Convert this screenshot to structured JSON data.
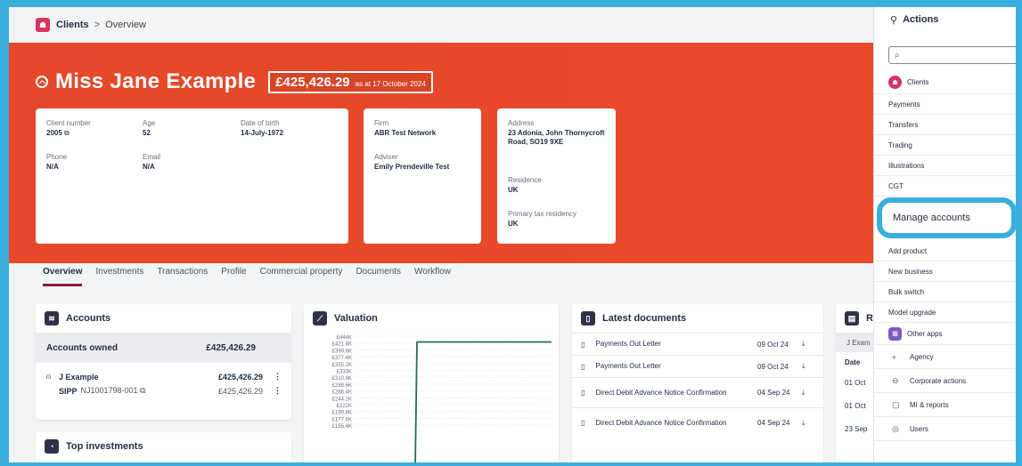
{
  "breadcrumb": {
    "root": "Clients",
    "sep": ">",
    "current": "Overview"
  },
  "client": {
    "name": "Miss Jane Example",
    "total": "£425,426.29",
    "as_at": "as at 17 October 2024",
    "labels": {
      "client_number": "Client number",
      "age": "Age",
      "dob": "Date of birth",
      "phone": "Phone",
      "email": "Email",
      "firm": "Firm",
      "adviser": "Adviser",
      "address": "Address",
      "residence": "Residence",
      "tax_residency": "Primary tax residency"
    },
    "client_number": "2005",
    "age": "52",
    "dob": "14-July-1972",
    "phone": "N/A",
    "email": "N/A",
    "firm": "ABR Test Network",
    "adviser": "Emily Prendeville Test",
    "address": "23 Adonia, John Thornycroft Road, SO19 9XE",
    "residence": "UK",
    "tax_residency": "UK"
  },
  "tabs": [
    "Overview",
    "Investments",
    "Transactions",
    "Profile",
    "Commercial property",
    "Documents",
    "Workflow"
  ],
  "accounts": {
    "title": "Accounts",
    "owned_label": "Accounts owned",
    "owned_total": "£425,426.29",
    "holder": {
      "name": "J Example",
      "value": "£425,426.29"
    },
    "product": {
      "name": "SIPP",
      "ref": "NJ1001798-001",
      "value": "£425,426.29"
    }
  },
  "top_investments": {
    "title": "Top investments"
  },
  "valuation": {
    "title": "Valuation",
    "y_ticks": [
      "£444K",
      "£421.8K",
      "£399.6K",
      "£377.4K",
      "£355.2K",
      "£333K",
      "£310.8K",
      "£288.6K",
      "£266.4K",
      "£244.2K",
      "£222K",
      "£199.8K",
      "£177.6K",
      "£155.4K"
    ]
  },
  "chart_data": {
    "type": "line",
    "title": "Valuation",
    "ylim": [
      155.4,
      444
    ],
    "series": [
      {
        "values": [
          0,
          0,
          425.4,
          425.4,
          425.4
        ]
      }
    ],
    "grid": true
  },
  "documents": {
    "title": "Latest documents",
    "rows": [
      {
        "name": "Payments Out Letter",
        "date": "09 Oct 24"
      },
      {
        "name": "Payments Out Letter",
        "date": "09 Oct 24"
      },
      {
        "name": "Direct Debit Advance Notice Confirmation",
        "date": "04 Sep 24"
      },
      {
        "name": "Direct Debit Advance Notice Confirmation",
        "date": "04 Sep 24"
      }
    ]
  },
  "recent": {
    "title": "R",
    "filter": "J Exam",
    "date_header": "Date",
    "dates": [
      "01 Oct",
      "01 Oct",
      "23 Sep"
    ]
  },
  "actions": {
    "title": "Actions",
    "search_placeholder": "",
    "clients_label": "Clients",
    "items_a": [
      "Payments",
      "Transfers",
      "Trading",
      "Illustrations",
      "CGT"
    ],
    "manage": "Manage accounts",
    "items_b": [
      "Add product",
      "New business",
      "Bulk switch",
      "Model upgrade"
    ],
    "other_apps": "Other apps",
    "items_c": [
      "Agency",
      "Corporate actions",
      "MI & reports",
      "Users"
    ]
  },
  "colors": {
    "hero": "#e7492a",
    "highlight": "#3aaedc",
    "chart_line": "#2e6b4f",
    "tab_active": "#8b1b3b"
  }
}
